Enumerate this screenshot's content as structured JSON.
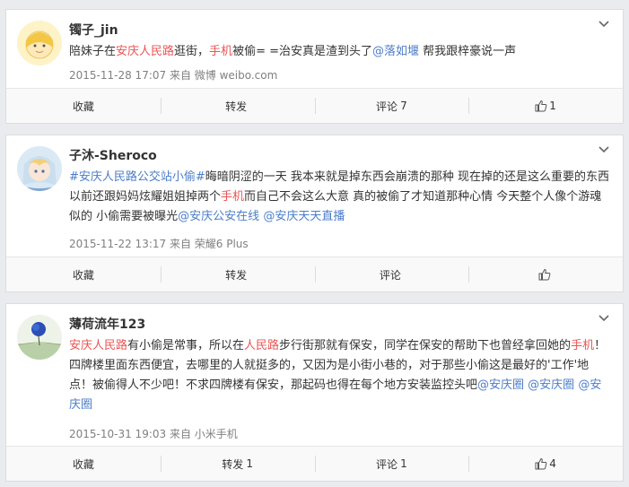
{
  "posts": [
    {
      "username": "镯子_jin",
      "content": [
        {
          "t": "陪妹子在",
          "c": ""
        },
        {
          "t": "安庆人民路",
          "c": "red"
        },
        {
          "t": "逛街，",
          "c": ""
        },
        {
          "t": "手机",
          "c": "red"
        },
        {
          "t": "被偷= =治安真是渣到头了",
          "c": ""
        },
        {
          "t": "@落如堰",
          "c": "blue"
        },
        {
          "t": " 帮我跟梓豪说一声",
          "c": ""
        }
      ],
      "meta": "2015-11-28 17:07 来自 微博 weibo.com",
      "actions": {
        "collect": "收藏",
        "repost": "转发",
        "repost_count": "",
        "comment": "评论",
        "comment_count": "7",
        "like_count": "1"
      }
    },
    {
      "username": "子沐-Sheroco",
      "content": [
        {
          "t": "#安庆人民路公交站小偷#",
          "c": "blue"
        },
        {
          "t": "晦暗阴涩的一天 我本来就是掉东西会崩溃的那种 现在掉的还是这么重要的东西 以前还跟妈妈炫耀姐姐掉两个",
          "c": ""
        },
        {
          "t": "手机",
          "c": "red"
        },
        {
          "t": "而自己不会这么大意 真的被偷了才知道那种心情 今天整个人像个游魂似的 小偷需要被曝光",
          "c": ""
        },
        {
          "t": "@安庆",
          "c": "blue"
        },
        {
          "t": "公安在线",
          "c": "blue"
        },
        {
          "t": " ",
          "c": ""
        },
        {
          "t": "@安庆天天直播",
          "c": "blue"
        }
      ],
      "meta": "2015-11-22 13:17 来自 荣耀6 Plus",
      "actions": {
        "collect": "收藏",
        "repost": "转发",
        "repost_count": "",
        "comment": "评论",
        "comment_count": "",
        "like_count": ""
      }
    },
    {
      "username": "薄荷流年123",
      "content": [
        {
          "t": "安庆人民路",
          "c": "red"
        },
        {
          "t": "有小偷是常事，所以在",
          "c": ""
        },
        {
          "t": "人民路",
          "c": "red"
        },
        {
          "t": "步行街那就有保安，同学在保安的帮助下也曾经拿回她的",
          "c": ""
        },
        {
          "t": "手机",
          "c": "red"
        },
        {
          "t": "！四牌楼里面东西便宜，去哪里的人就挺多的，又因为是小街小巷的，对于那些小偷这是最好的'工作'地点！被偷得人不少吧！不求四牌楼有保安，那起码也得在每个地方安装监控头吧",
          "c": ""
        },
        {
          "t": "@安庆圈",
          "c": "blue"
        },
        {
          "t": " ",
          "c": ""
        },
        {
          "t": "@安庆圈",
          "c": "blue"
        },
        {
          "t": " ",
          "c": ""
        },
        {
          "t": "@安庆圈",
          "c": "blue"
        }
      ],
      "meta": "2015-10-31 19:03 来自 小米手机",
      "actions": {
        "collect": "收藏",
        "repost": "转发",
        "repost_count": "1",
        "comment": "评论",
        "comment_count": "1",
        "like_count": "4"
      }
    }
  ],
  "colors": {
    "red_link": "#eb5454",
    "blue_link": "#4b7dc9",
    "meta_gray": "#808080"
  }
}
